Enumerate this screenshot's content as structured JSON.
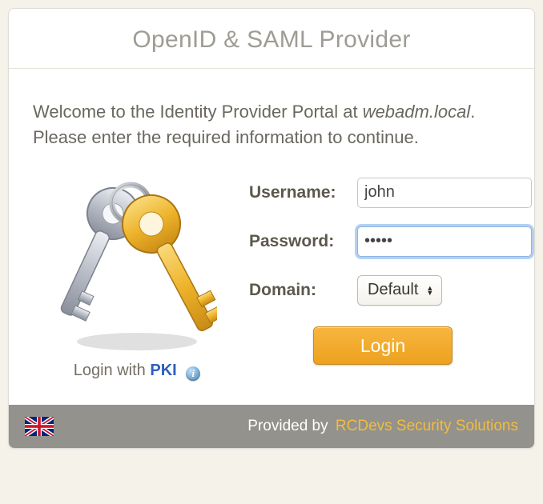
{
  "header": {
    "title": "OpenID & SAML Provider"
  },
  "intro": {
    "prefix": "Welcome to the Identity Provider Portal at ",
    "host": "webadm.local",
    "suffix1": ".",
    "line2": "Please enter the required information to continue."
  },
  "form": {
    "username_label": "Username:",
    "username_value": "john",
    "password_label": "Password:",
    "password_value": "•••••",
    "domain_label": "Domain:",
    "domain_value": "Default",
    "login_button": "Login"
  },
  "pki": {
    "prefix": "Login with ",
    "label": "PKI"
  },
  "footer": {
    "provided": "Provided by",
    "vendor": "RCDevs Security Solutions"
  }
}
